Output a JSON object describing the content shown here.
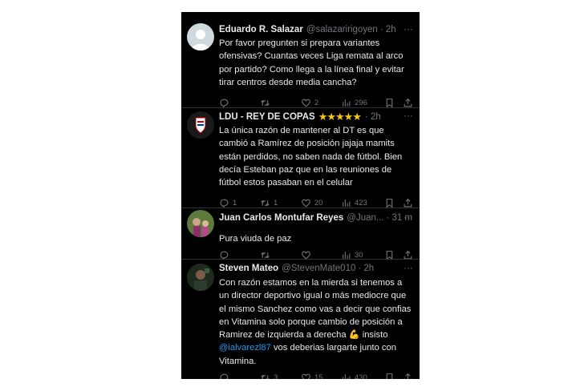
{
  "tweets": [
    {
      "name": "Eduardo R. Salazar",
      "handle": "@salazaririgoyen",
      "time": "· 2h",
      "lines": [
        "Por favor pregunten si prepara variantes",
        "ofensivas? Cuantas veces Liga remata al arco",
        "por partido? Como llega a la línea final y evitar",
        "tirar centros desde media cancha?"
      ],
      "replies": "",
      "retweets": "",
      "likes": "2",
      "views": "296",
      "avatar": "default-avatar"
    },
    {
      "name": "LDU - REY DE COPAS",
      "stars": "★★★★★",
      "handle": "",
      "time": "· 2h",
      "lines": [
        "La única razón de mantener al DT es que",
        "cambió a Ramírez de posición jajaja mamits",
        "están perdidos, no saben nada de fútbol. Bien",
        "decía Esteban paz que en las reuniones de",
        "fútbol estos pasaban en el celular"
      ],
      "replies": "1",
      "retweets": "1",
      "likes": "20",
      "views": "423",
      "avatar": "ldu-crest-avatar"
    },
    {
      "name": "Juan Carlos Montufar Reyes",
      "handle": "@Juan...",
      "time": "· 31 m",
      "lines": [
        "Pura viuda de paz"
      ],
      "replies": "",
      "retweets": "",
      "likes": "",
      "views": "30",
      "avatar": "photo-avatar"
    },
    {
      "name": "Steven Mateo",
      "handle": "@StevenMate010",
      "time": "· 2h",
      "lines": [
        "Con razón estamos en la mierda si tenemos a",
        "un director deportivo igual o más mediocre que",
        "el mismo Sanchez como vas a decir que confias",
        "en Vitamina solo porque cambio de posición a",
        "Ramirez de izquierda a derecha 💪 insisto"
      ],
      "mention": "@ialvarezl87",
      "mention_rest": " vos deberias largarte junto con",
      "last_line": "Vitamina.",
      "replies": "",
      "retweets": "3",
      "likes": "15",
      "views": "430",
      "avatar": "photo-avatar-dark"
    }
  ],
  "more_label": "···",
  "colors": {
    "background": "#000000",
    "text": "#e7e9ea",
    "muted": "#71767b",
    "link": "#1d9bf0",
    "divider": "#2f3336"
  }
}
